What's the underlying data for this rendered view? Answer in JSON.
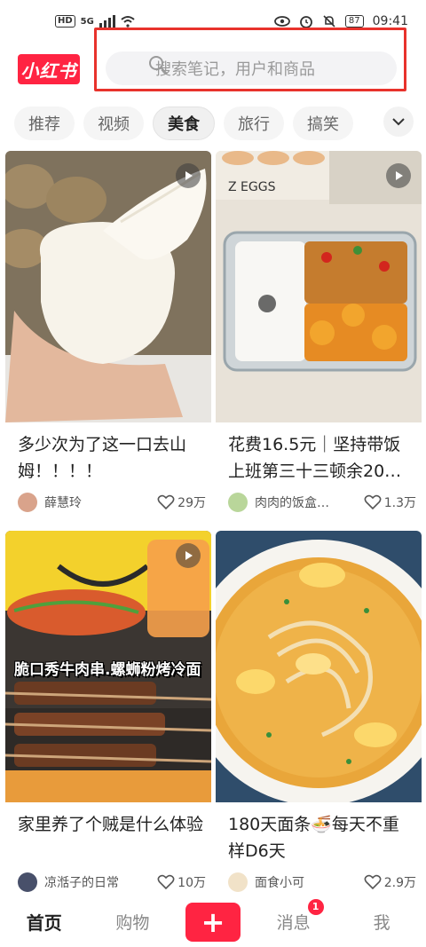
{
  "status_bar": {
    "hd_badge": "HD",
    "signal": "5G",
    "battery": "87",
    "time": "09:41"
  },
  "header": {
    "logo_text": "小红书",
    "search_placeholder": "搜索笔记，用户和商品"
  },
  "tabs": [
    {
      "label": "推荐",
      "active": false
    },
    {
      "label": "视频",
      "active": false
    },
    {
      "label": "美食",
      "active": true
    },
    {
      "label": "旅行",
      "active": false
    },
    {
      "label": "搞笑",
      "active": false
    }
  ],
  "feed": [
    {
      "title": "多少次为了这一口去山姆！！！！",
      "author": "薛慧玲",
      "likes": "29万",
      "has_video": true
    },
    {
      "title": "花费16.5元｜坚持带饭上班第三十三顿余20…",
      "author": "肉肉的饭盒…",
      "likes": "1.3万",
      "has_video": true
    },
    {
      "title": "家里养了个贼是什么体验",
      "author": "凉湉子的日常",
      "likes": "10万",
      "has_video": true,
      "overlay_text": "脆口秀牛肉串.螺蛳粉烤冷面"
    },
    {
      "title": "180天面条🍜每天不重样D6天",
      "author": "面食小可",
      "likes": "2.9万",
      "has_video": false
    }
  ],
  "bottom_nav": {
    "home": "首页",
    "shop": "购物",
    "publish": "+",
    "messages": "消息",
    "messages_badge": "1",
    "me": "我"
  },
  "colors": {
    "brand": "#ff2442",
    "highlight_border": "#e8322c"
  }
}
